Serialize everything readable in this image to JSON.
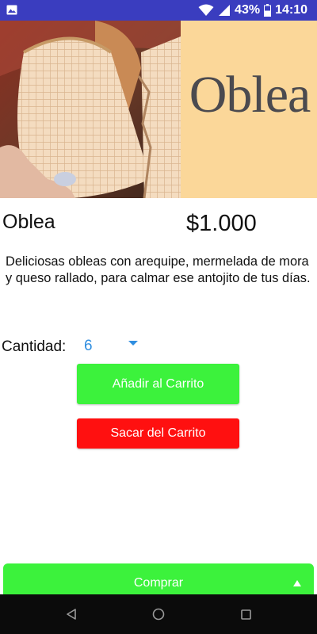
{
  "status_bar": {
    "battery_percent": "43%",
    "time": "14:10",
    "icons": [
      "image-icon",
      "wifi-icon",
      "signal-icon",
      "battery-icon"
    ]
  },
  "hero": {
    "brand_text": "Oblea",
    "colors": {
      "panel": "#fbd799",
      "text": "#4b4a4f"
    }
  },
  "product": {
    "name": "Oblea",
    "price": "$1.000",
    "description": "Deliciosas obleas con arequipe, mermelada de mora y queso rallado, para calmar ese antojito de tus días."
  },
  "quantity": {
    "label": "Cantidad:",
    "selected": "6"
  },
  "actions": {
    "add_label": "Añadir al Carrito",
    "remove_label": "Sacar del Carrito",
    "buy_label": "Comprar"
  },
  "colors": {
    "status_bar": "#3a3dbf",
    "add_button": "#3cf23c",
    "remove_button": "#ff1010",
    "buy_bar": "#3cf23c",
    "spinner_accent": "#2f8ee0"
  },
  "nav": {
    "icons": [
      "back-icon",
      "home-icon",
      "recents-icon"
    ]
  }
}
